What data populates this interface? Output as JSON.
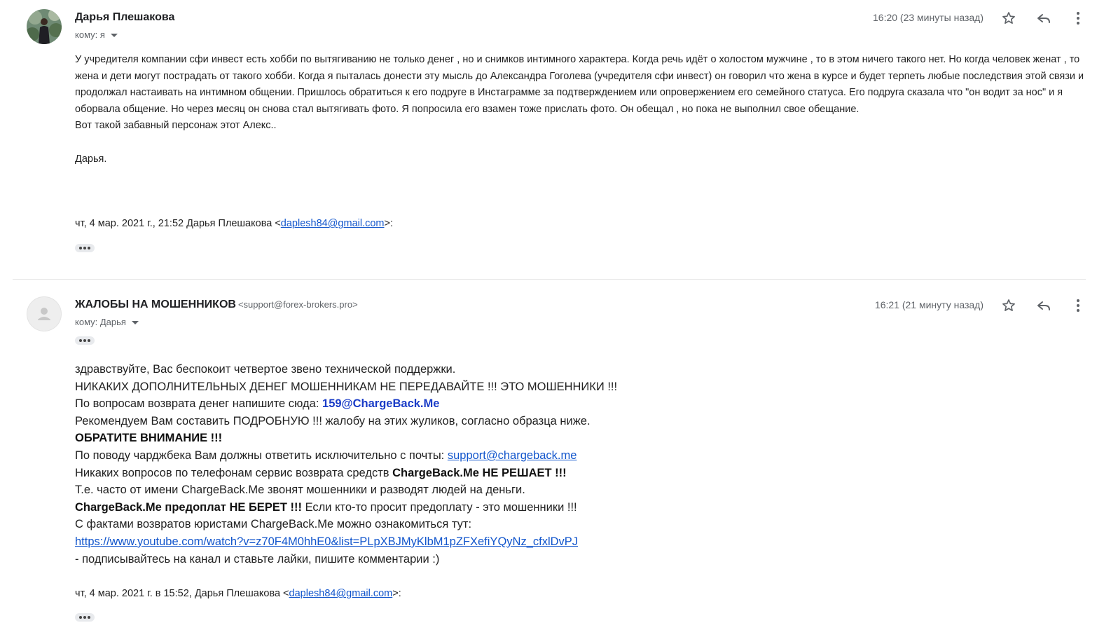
{
  "messages": [
    {
      "sender_name": "Дарья Плешакова",
      "to_label": "кому: я",
      "time": "16:20 (23 минуты назад)",
      "body_paragraph": "У учредителя компании сфи инвест есть хобби по вытягиванию не только денег , но и снимков интимного характера. Когда речь идёт о холостом мужчине , то в этом ничего такого нет. Но когда человек женат , то жена и дети могут пострадать от такого хобби. Когда я пыталась донести эту мысль до Александра Гоголева (учредителя сфи инвест) он говорил что жена в курсе и будет терпеть любые последствия этой связи   и продолжал настаивать на интимном общении. Пришлось обратиться к его подруге в Инстаграмме за подтверждением или опровержением его семейного статуса. Его подруга сказала что \"он водит за нос\" и  я оборвала общение. Но через месяц он снова стал вытягивать фото. Я попросила его взамен тоже прислать фото. Он обещал , но пока не выполнил свое обещание.",
      "body_line2": "Вот такой забавный персонаж этот Алекс..",
      "signature": "Дарья.",
      "quote_prefix": "чт, 4 мар. 2021 г., 21:52 Дарья Плешакова <",
      "quote_email": "daplesh84@gmail.com",
      "quote_suffix": ">:"
    },
    {
      "sender_name": "ЖАЛОБЫ НА МОШЕННИКОВ",
      "sender_email": "<support@forex-brokers.pro>",
      "to_label": "кому: Дарья",
      "time": "16:21 (21 минуту назад)",
      "lines": {
        "l1": "здравствуйте, Вас беспокоит четвертое звено технической поддержки.",
        "l2": "НИКАКИХ ДОПОЛНИТЕЛЬНЫХ ДЕНЕГ МОШЕННИКАМ НЕ ПЕРЕДАВАЙТЕ !!! ЭТО МОШЕННИКИ !!!",
        "l3_text": "По вопросам возврата денег напишите сюда: ",
        "l3_email": "159@ChargeBack.Me",
        "l4": "Рекомендуем Вам составить ПОДРОБНУЮ !!! жалобу на этих жуликов, согласно образца ниже.",
        "l5": "ОБРАТИТЕ ВНИМАНИЕ !!!",
        "l6_text": "По поводу чарджбека Вам должны ответить исключительно с почты: ",
        "l6_link": "support@chargeback.me",
        "l7_text": "Никаких вопросов по телефонам сервис возврата средств ",
        "l7_bold": "ChargeBack.Me НЕ РЕШАЕТ !!!",
        "l8": "Т.е. часто от имени ChargeBack.Me звонят мошенники и разводят людей на деньги.",
        "l9_bold": "ChargeBack.Me предоплат НЕ БЕРЕТ !!!",
        "l9_text": " Если кто-то просит предоплату - это мошенники !!!",
        "l10": "С фактами возвратов юристами ChargeBack.Me можно ознакомиться тут:",
        "l11_link": "https://www.youtube.com/watch?v=z70F4M0hhE0&list=PLpXBJMyKlbM1pZFXefiYQyNz_cfxlDvPJ",
        "l12": " - подписывайтесь на канал и ставьте лайки, пишите комментарии :)"
      },
      "quote_prefix": "чт, 4 мар. 2021 г. в 15:52, Дарья Плешакова <",
      "quote_email": "daplesh84@gmail.com",
      "quote_suffix": ">:"
    }
  ],
  "icons": {
    "star": "star-icon",
    "reply": "reply-icon",
    "more": "more-vert-icon",
    "expand": "ellipsis-icon",
    "caret": "chevron-down-icon"
  }
}
